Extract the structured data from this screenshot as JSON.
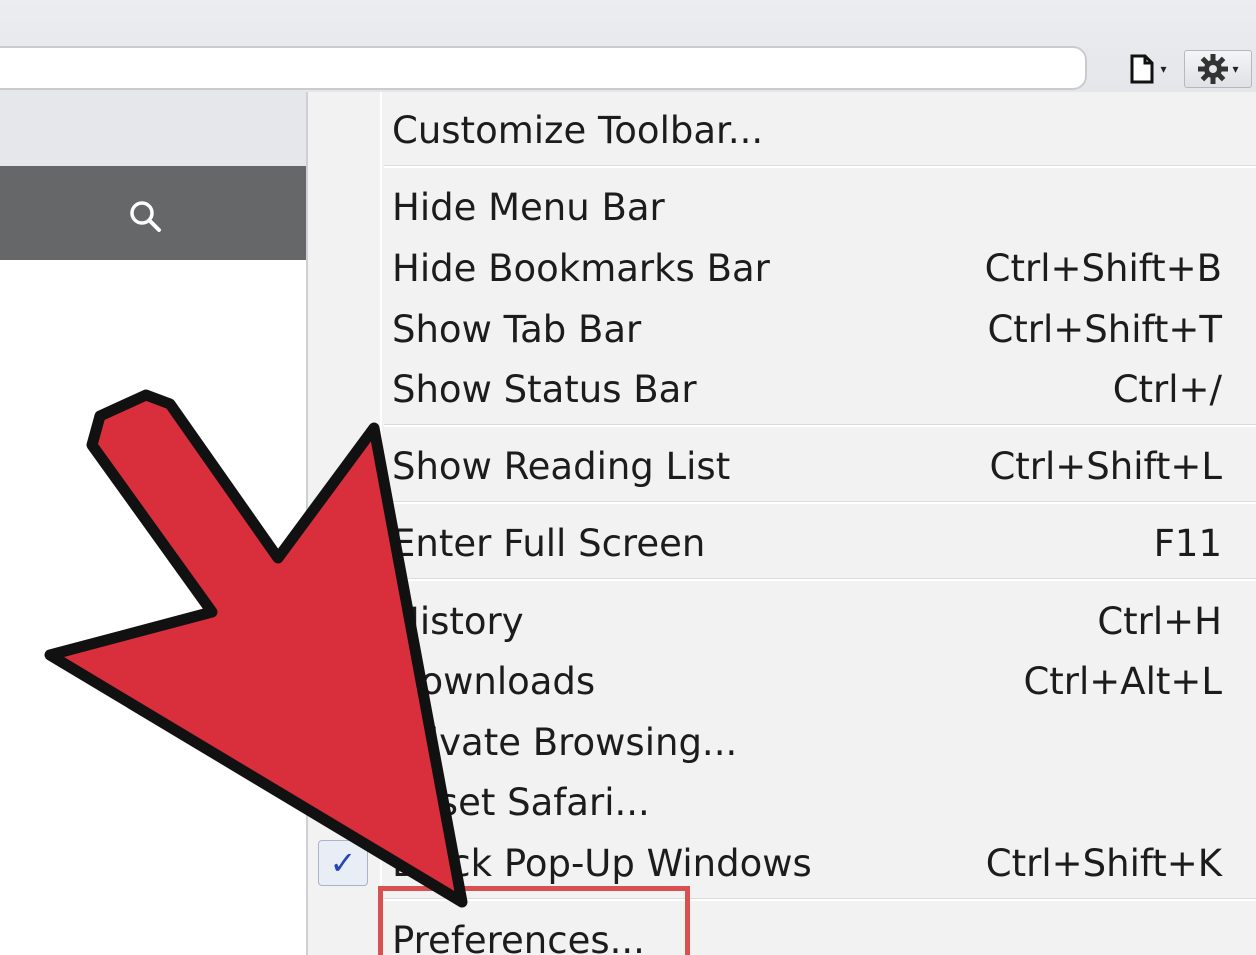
{
  "toolbar": {
    "page_icon": "page-icon",
    "gear_icon": "gear-icon",
    "caret": "▾"
  },
  "sidebar": {
    "search_icon": "search-icon"
  },
  "menu": {
    "items": [
      {
        "label": "Customize Toolbar...",
        "shortcut": ""
      },
      {
        "label": "Hide Menu Bar",
        "shortcut": ""
      },
      {
        "label": "Hide Bookmarks Bar",
        "shortcut": "Ctrl+Shift+B"
      },
      {
        "label": "Show Tab Bar",
        "shortcut": "Ctrl+Shift+T"
      },
      {
        "label": "Show Status Bar",
        "shortcut": "Ctrl+/"
      },
      {
        "label": "Show Reading List",
        "shortcut": "Ctrl+Shift+L"
      },
      {
        "label": "Enter Full Screen",
        "shortcut": "F11"
      },
      {
        "label": "History",
        "shortcut": "Ctrl+H"
      },
      {
        "label": "Downloads",
        "shortcut": "Ctrl+Alt+L"
      },
      {
        "label": "Private Browsing...",
        "shortcut": ""
      },
      {
        "label": "Reset Safari...",
        "shortcut": ""
      },
      {
        "label": "Block Pop-Up Windows",
        "shortcut": "Ctrl+Shift+K",
        "checked": true
      },
      {
        "label": "Preferences...",
        "shortcut": ""
      }
    ],
    "check_mark": "✓"
  },
  "annotation": {
    "arrow_color": "#d92f3c",
    "highlight_color": "#d8504f",
    "highlighted_item": "Preferences..."
  }
}
